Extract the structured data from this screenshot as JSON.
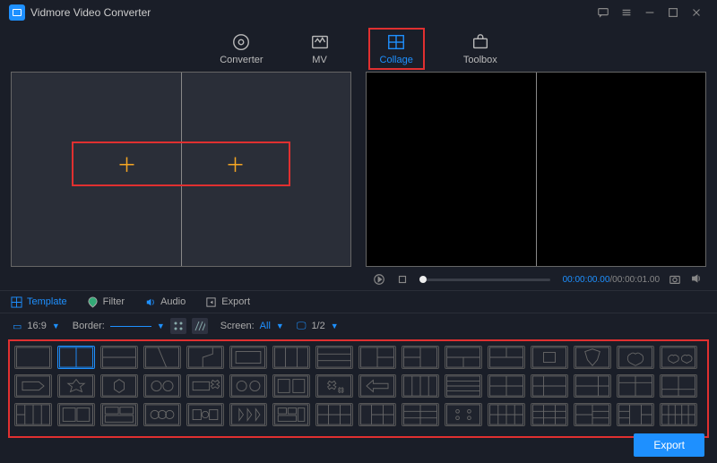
{
  "app": {
    "title": "Vidmore Video Converter"
  },
  "nav": {
    "converter": "Converter",
    "mv": "MV",
    "collage": "Collage",
    "toolbox": "Toolbox"
  },
  "playbar": {
    "current": "00:00:00.00",
    "total": "00:00:01.00"
  },
  "tabs": {
    "template": "Template",
    "filter": "Filter",
    "audio": "Audio",
    "export": "Export"
  },
  "toolbar": {
    "ratio": "16:9",
    "border_label": "Border:",
    "screen_label": "Screen:",
    "screen_value": "All",
    "page": "1/2"
  },
  "footer": {
    "export": "Export"
  }
}
